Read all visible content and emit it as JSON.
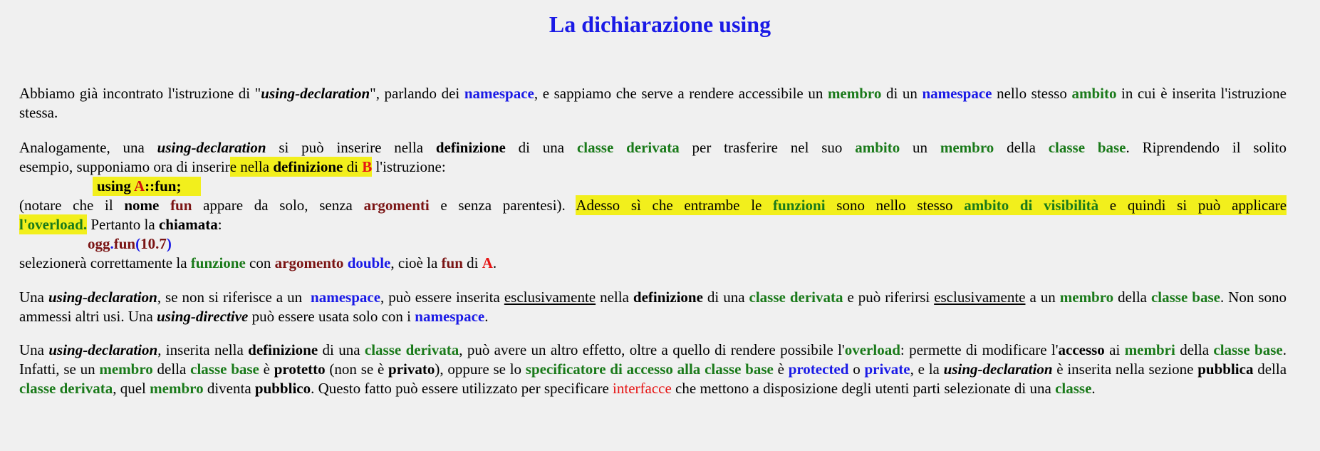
{
  "title": "La dichiarazione using",
  "p1": {
    "t1": "Abbiamo già incontrato l'istruzione di \"",
    "t2": "using-declaration",
    "t3": "\", parlando dei ",
    "t4": "namespace",
    "t5": ", e sappiamo che serve a rendere accessibile un ",
    "t6": "membro",
    "t7": " di un ",
    "t8": "namespace",
    "t9": " nello stesso ",
    "t10": "ambito",
    "t11": " in cui è inserita l'istruzione stessa."
  },
  "p2": {
    "t1": "Analogamente, una ",
    "t2": "using-declaration",
    "t3": " si può inserire nella ",
    "t4": "definizione",
    "t5": " di una ",
    "t6": "classe derivata",
    "t7": " per trasferire nel suo ",
    "t8": "ambito",
    "t9": " un ",
    "t10": "membro",
    "t11": " della ",
    "t12": "classe base",
    "t13": ". Riprendendo il solito",
    "t14": "esempio, supponiamo ora di inserir",
    "t15": "e nella ",
    "t16": "definizione",
    "t17": " di ",
    "t18": "B",
    "t19": " l'istruzione:"
  },
  "code1": {
    "kw": "using ",
    "cls": "A",
    "rest": "::fun;"
  },
  "p3": {
    "t1": "(notare che il ",
    "t2": "nome",
    "t3": " ",
    "t4": "fun",
    "t5": " appare da solo, senza ",
    "t6": "argomenti",
    "t7": " e senza parentesi). ",
    "t8": "Adesso sì che entrambe le ",
    "t9": "funzioni",
    "t10": " sono nello stesso ",
    "t11": "ambito di visibilità",
    "t12": " e quindi si può applicare",
    "t13": "l'overload.",
    "t14": " Pertanto la ",
    "t15": "chiamata",
    "t16": ":"
  },
  "code2": {
    "obj": "ogg",
    "dot": ".",
    "fn": "fun",
    "open": "(",
    "num": "10.7",
    "close": ")"
  },
  "p4": {
    "t1": "selezionerà correttamente la ",
    "t2": "funzione",
    "t3": " con ",
    "t4": "argomento",
    "t5": " ",
    "t6": "double",
    "t7": ", cioè la ",
    "t8": "fun",
    "t9": " di ",
    "t10": "A",
    "t11": "."
  },
  "p5": {
    "t1": "Una ",
    "t2": "using-declaration",
    "t3": ", se non si riferisce a un  ",
    "t4": "namespace",
    "t5": ", può essere inserita ",
    "t6": "esclusivamente",
    "t7": " nella ",
    "t8": "definizione",
    "t9": " di una ",
    "t10": "classe derivata",
    "t11": " e può riferirsi ",
    "t12": "esclusivamente",
    "t13": " a un ",
    "t14": "membro",
    "t15": " della ",
    "t16": "classe base",
    "t17": ". Non sono ammessi altri usi. Una ",
    "t18": "using-directive",
    "t19": " può essere usata solo con i ",
    "t20": "namespace",
    "t21": "."
  },
  "p6": {
    "t1": "Una ",
    "t2": "using-declaration",
    "t3": ", inserita nella ",
    "t4": "definizione",
    "t5": " di una ",
    "t6": "classe derivata",
    "t7": ", può avere un altro effetto, oltre a quello di rendere possibile l'",
    "t8": "overload",
    "t9": ": permette di modificare l'",
    "t10": "accesso",
    "t11": " ai ",
    "t12": "membri",
    "t13": " della ",
    "t14": "classe base",
    "t15": ". Infatti, se un ",
    "t16": "membro",
    "t17": " della ",
    "t18": "classe base",
    "t19": " è ",
    "t20": "protetto",
    "t21": " (non se è ",
    "t22": "privato",
    "t23": "), oppure se lo ",
    "t24": "specificatore di accesso alla classe base",
    "t25": " è ",
    "t26": "protected",
    "t27": " o ",
    "t28": "private",
    "t29": ", e la ",
    "t30": "using-declaration",
    "t31": " è inserita nella sezione ",
    "t32": "pubblica",
    "t33": " della ",
    "t34": "classe derivata",
    "t35": ", quel ",
    "t36": "membro",
    "t37": " diventa ",
    "t38": "pubblico",
    "t39": ". Questo fatto può essere utilizzato per specificare ",
    "t40": "interfacce",
    "t41": " che mettono a disposizione degli utenti parti selezionate di una ",
    "t42": "classe",
    "t43": "."
  },
  "colors": {
    "title": "#1a1ae6",
    "green": "#1a7a1a",
    "blue": "#1a1ae6",
    "maroon": "#7a1414",
    "red": "#e61414",
    "highlight": "#f2ef1c"
  }
}
